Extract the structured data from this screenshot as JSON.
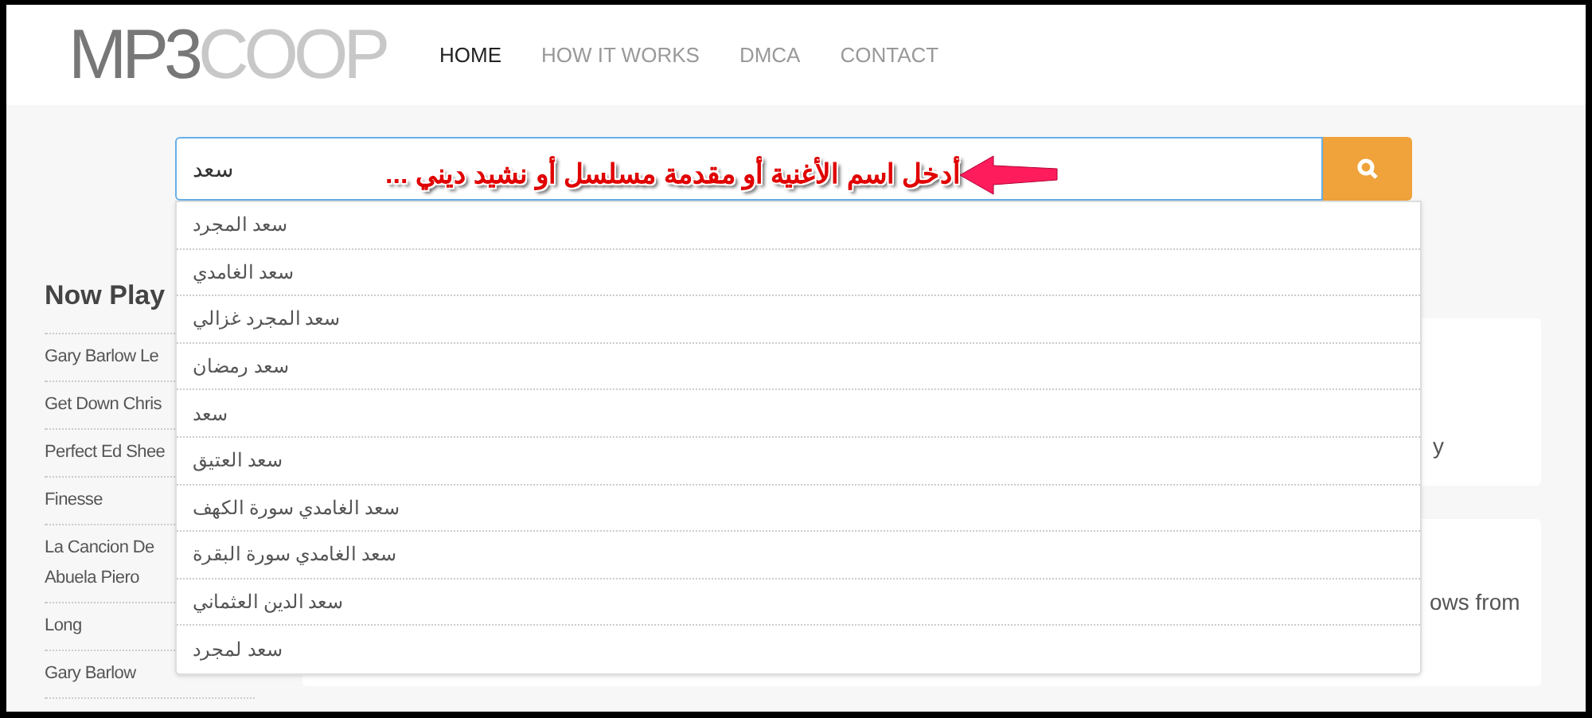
{
  "logo": {
    "dark_part": "MP3",
    "light_part": "COOP"
  },
  "nav": {
    "home": {
      "label": "HOME",
      "selected": true
    },
    "how_it_works": {
      "label": "HOW IT WORKS",
      "selected": false
    },
    "dmca": {
      "label": "DMCA",
      "selected": false
    },
    "contact": {
      "label": "CONTACT",
      "selected": false
    }
  },
  "search": {
    "value": "سعد",
    "annotation": "أدخل اسم الأغنية أو مقدمة مسلسل أو نشيد ديني ..."
  },
  "suggestions": [
    "سعد المجرد",
    "سعد الغامدي",
    "سعد المجرد غزالي",
    "سعد رمضان",
    "سعد",
    "سعد العتيق",
    "سعد الغامدي سورة الكهف",
    "سعد الغامدي سورة البقرة",
    "سعد الدين العثماني",
    "سعد لمجرد"
  ],
  "now_playing": {
    "title": "Now Play",
    "items": [
      "Gary Barlow Le",
      "Get Down Chris",
      "Perfect Ed Shee",
      "Finesse",
      "La Cancion De Abuela Piero",
      "Long",
      "Gary Barlow"
    ]
  },
  "cards": [
    {
      "text": "y"
    },
    {
      "text": "ows from"
    }
  ]
}
